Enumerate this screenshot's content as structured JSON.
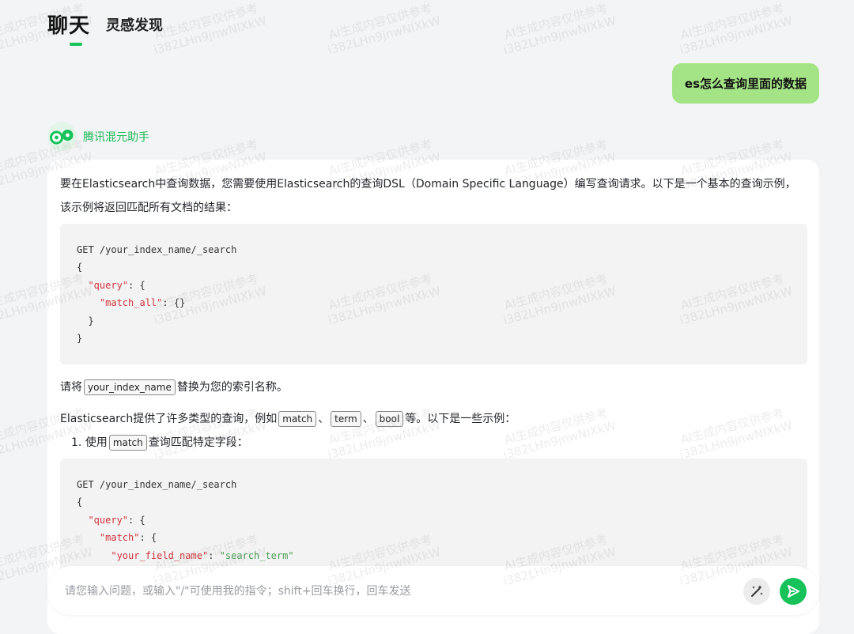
{
  "nav": {
    "active_tab": "聊天",
    "second_tab": "灵感发现"
  },
  "conversation": {
    "user_message": "es怎么查询里面的数据",
    "assistant_name": "腾讯混元助手",
    "answer": {
      "intro": "要在Elasticsearch中查询数据，您需要使用Elasticsearch的查询DSL（Domain Specific Language）编写查询请求。以下是一个基本的查询示例，该示例将返回匹配所有文档的结果：",
      "code1": {
        "l1": "GET /your_index_name/_search",
        "l2": "{",
        "l3_key": "\"query\"",
        "l3_rest": ": {",
        "l4_key": "\"match_all\"",
        "l4_rest": ": {}",
        "l5": "  }",
        "l6": "}"
      },
      "replace_pre": "请将",
      "replace_code": "your_index_name",
      "replace_post": "替换为您的索引名称。",
      "types_pre": "Elasticsearch提供了许多类型的查询，例如",
      "type1": "match",
      "sep": "、",
      "type2": "term",
      "type3": "bool",
      "types_post": "等。以下是一些示例：",
      "list_num": "1.",
      "list_pre": "使用",
      "list_code": "match",
      "list_post": "查询匹配特定字段：",
      "code2": {
        "l1": "GET /your_index_name/_search",
        "l2": "{",
        "l3_key": "\"query\"",
        "l3_rest": ": {",
        "l4_key": "\"match\"",
        "l4_rest": ": {",
        "l5_key": "\"your_field_name\"",
        "l5_sep": ": ",
        "l5_val": "\"search_term\""
      }
    }
  },
  "input": {
    "placeholder": "请您输入问题，或输入\"/\"可使用我的指令；shift+回车换行，回车发送"
  },
  "watermark": {
    "line1": "AI生成内容仅供参考",
    "line2": "i382LHn9jnwNIXkW"
  },
  "icons": {
    "avatar": "hunyuan-logo-icon",
    "magic": "magic-wand-icon",
    "send": "send-icon"
  },
  "colors": {
    "accent": "#17c25a",
    "user_bubble": "#a5e486",
    "code_key": "#d1343d",
    "code_string": "#4b9f53"
  }
}
